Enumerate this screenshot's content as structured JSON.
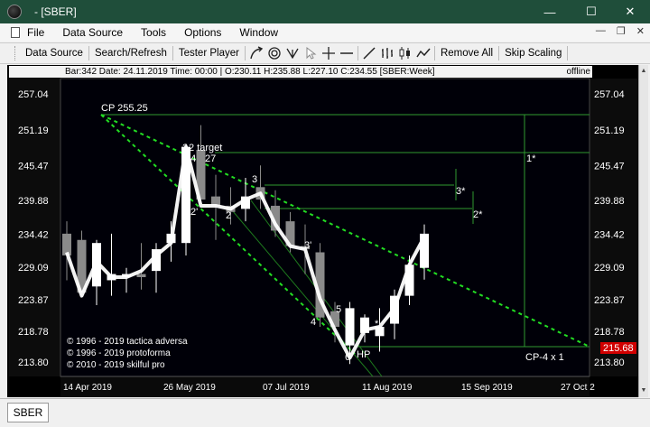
{
  "window": {
    "title": "- [SBER]",
    "minimize": "—",
    "maximize": "☐",
    "close": "✕"
  },
  "menu": {
    "items": [
      "File",
      "Data Source",
      "Tools",
      "Options",
      "Window"
    ],
    "mdi_controls": [
      "—",
      "❐",
      "✕"
    ]
  },
  "toolbar": {
    "data_source": "Data Source",
    "search_refresh": "Search/Refresh",
    "tester_player": "Tester Player",
    "remove_all": "Remove All",
    "skip_scaling": "Skip Scaling",
    "icons": [
      "curve-arrow-icon",
      "spiral-icon",
      "pitchfork-icon",
      "cursor-icon",
      "crosshair-icon",
      "horizontal-line-icon",
      "trendline-icon",
      "bar-chart-icon",
      "candlestick-icon",
      "line-chart-icon"
    ]
  },
  "info_bar": {
    "text": "Bar:342 Date: 24.11.2019 Time: 00:00 | O:230.11 H:235.88 L:227.10 C:234.55  [SBER:Week]",
    "status": "offline"
  },
  "chart_data": {
    "type": "candlestick",
    "symbol": "SBER",
    "timeframe": "Week",
    "price_axis": {
      "ticks": [
        257.04,
        251.19,
        245.47,
        239.88,
        234.42,
        229.09,
        223.87,
        218.78,
        213.8
      ],
      "ylim": [
        211.5,
        259.5
      ],
      "current_price_label": "215.68",
      "current_price_color": "#d10000"
    },
    "time_axis": {
      "ticks": [
        "14 Apr 2019",
        "26 May 2019",
        "07 Jul 2019",
        "11 Aug 2019",
        "15 Sep 2019",
        "27 Oct 2"
      ]
    },
    "candles": [
      {
        "o": 234.5,
        "h": 236.5,
        "l": 227.0,
        "c": 231.0
      },
      {
        "o": 233.5,
        "h": 235.0,
        "l": 224.5,
        "c": 225.0
      },
      {
        "o": 226.0,
        "h": 233.5,
        "l": 223.0,
        "c": 233.0
      },
      {
        "o": 227.0,
        "h": 234.5,
        "l": 224.5,
        "c": 228.0
      },
      {
        "o": 227.5,
        "h": 229.0,
        "l": 225.0,
        "c": 228.0
      },
      {
        "o": 228.0,
        "h": 233.0,
        "l": 225.5,
        "c": 227.5
      },
      {
        "o": 228.5,
        "h": 233.0,
        "l": 225.0,
        "c": 232.0
      },
      {
        "o": 233.0,
        "h": 236.5,
        "l": 230.0,
        "c": 234.5
      },
      {
        "o": 233.0,
        "h": 249.0,
        "l": 231.0,
        "c": 248.5
      },
      {
        "o": 248.0,
        "h": 252.0,
        "l": 244.0,
        "c": 240.0
      },
      {
        "o": 240.5,
        "h": 244.0,
        "l": 233.5,
        "c": 239.0
      },
      {
        "o": 239.0,
        "h": 242.0,
        "l": 236.0,
        "c": 238.0
      },
      {
        "o": 238.5,
        "h": 243.5,
        "l": 236.5,
        "c": 240.5
      },
      {
        "o": 242.0,
        "h": 245.5,
        "l": 238.5,
        "c": 240.0
      },
      {
        "o": 239.0,
        "h": 241.5,
        "l": 234.0,
        "c": 235.0
      },
      {
        "o": 236.5,
        "h": 238.0,
        "l": 231.5,
        "c": 232.5
      },
      {
        "o": 232.5,
        "h": 236.0,
        "l": 228.0,
        "c": 232.0
      },
      {
        "o": 231.5,
        "h": 233.0,
        "l": 219.5,
        "c": 221.0
      },
      {
        "o": 222.0,
        "h": 223.5,
        "l": 217.0,
        "c": 219.5
      },
      {
        "o": 216.5,
        "h": 223.5,
        "l": 213.5,
        "c": 222.5
      },
      {
        "o": 218.5,
        "h": 221.5,
        "l": 217.0,
        "c": 221.0
      },
      {
        "o": 218.0,
        "h": 222.5,
        "l": 215.5,
        "c": 219.5
      },
      {
        "o": 220.0,
        "h": 225.5,
        "l": 217.5,
        "c": 224.5
      },
      {
        "o": 224.5,
        "h": 231.0,
        "l": 223.0,
        "c": 229.5
      },
      {
        "o": 229.0,
        "h": 236.0,
        "l": 227.1,
        "c": 234.5
      }
    ],
    "bull_color": "#ffffff",
    "bear_color": "#8a8a8a",
    "overlay_line": [
      231.5,
      224.5,
      230.0,
      227.5,
      227.5,
      228.5,
      231.0,
      233.0,
      248.5,
      239.0,
      239.0,
      238.5,
      240.0,
      241.0,
      236.0,
      232.5,
      232.0,
      224.0,
      219.0,
      214.5,
      219.0,
      219.5,
      222.5,
      229.5,
      234.0
    ],
    "overlay_color": "#ffffff",
    "trend_color": "#22dd22",
    "annotations": [
      {
        "text": "CP  255.25",
        "price": 255.25
      },
      {
        "text": "2",
        "kind": "wave"
      },
      {
        "text": "2 target",
        "kind": "wave"
      },
      {
        "text": "24",
        "kind": "wave"
      },
      {
        "text": "27",
        "kind": "wave"
      },
      {
        "text": "3",
        "kind": "wave"
      },
      {
        "text": "2'",
        "kind": "wave"
      },
      {
        "text": "2",
        "kind": "wave"
      },
      {
        "text": "3'",
        "kind": "wave"
      },
      {
        "text": "4",
        "kind": "wave"
      },
      {
        "text": "5",
        "kind": "wave"
      },
      {
        "text": "6",
        "kind": "wave"
      },
      {
        "text": "HP",
        "kind": "wave"
      },
      {
        "text": "*",
        "kind": "wave"
      },
      {
        "text": "1*",
        "kind": "target"
      },
      {
        "text": "3*",
        "kind": "target"
      },
      {
        "text": "2*",
        "kind": "target"
      },
      {
        "text": "CP-4 x 1",
        "kind": "target"
      }
    ],
    "copyright": [
      "© 1996 - 2019 tactica adversa",
      "© 1996 - 2019 protoforma",
      "© 2010 - 2019 skilful pro"
    ]
  },
  "bottom_tab": {
    "label": "SBER"
  }
}
